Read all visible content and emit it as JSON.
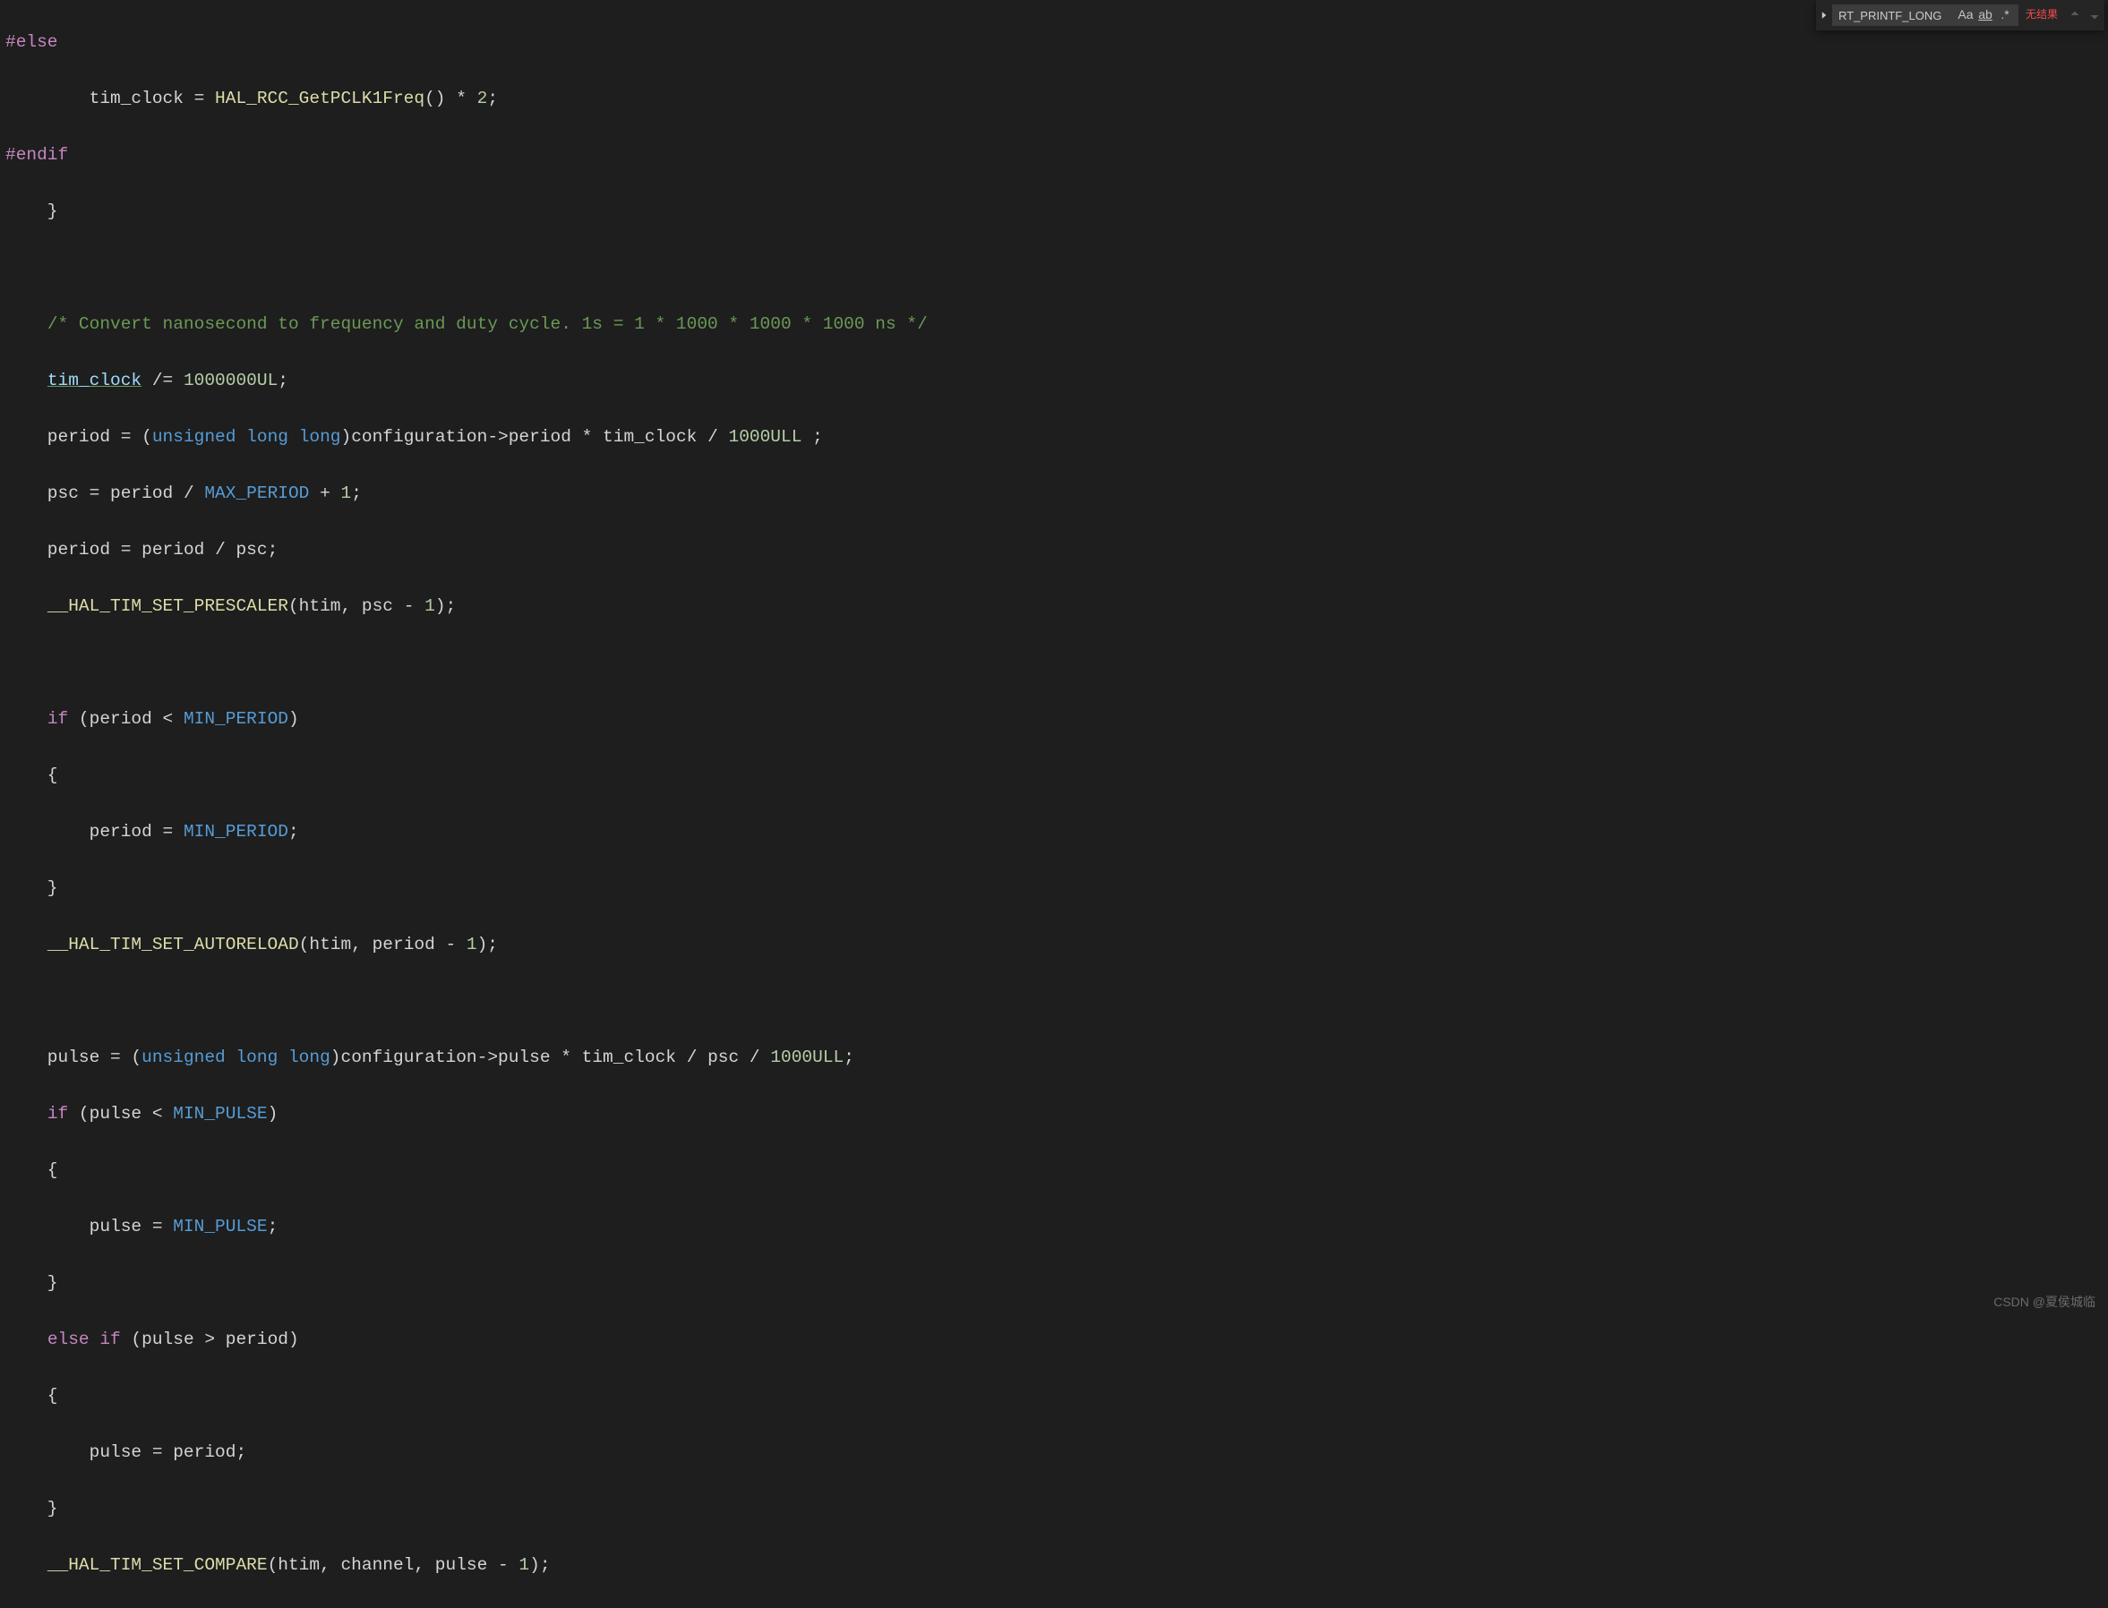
{
  "find": {
    "value": "RT_PRINTF_LONG",
    "result": "无结果",
    "opt_case": "Aa",
    "opt_word": "ab",
    "opt_regex": ".*"
  },
  "watermark": "CSDN @夏侯城临",
  "code": {
    "l0": {
      "a": "#else"
    },
    "l1": {
      "a": "        tim_clock ",
      "b": "=",
      "c": " ",
      "d": "HAL_RCC_GetPCLK1Freq",
      "e": "() ",
      "f": "*",
      "g": " ",
      "h": "2",
      "i": ";"
    },
    "l2": {
      "a": "#endif"
    },
    "l3": {
      "a": "    }"
    },
    "l4": {
      "a": ""
    },
    "l5": {
      "a": "    ",
      "b": "/* Convert nanosecond to frequency and duty cycle. 1s = 1 * 1000 * 1000 * 1000 ns */"
    },
    "l6": {
      "a": "    ",
      "b": "tim_clock",
      "c": " ",
      "d": "/=",
      "e": " ",
      "f": "1000000UL",
      "g": ";"
    },
    "l7": {
      "a": "    period ",
      "b": "=",
      "c": " (",
      "d": "unsigned",
      "e": " ",
      "f": "long",
      "g": " ",
      "h": "long",
      "i": ")configuration",
      "j": "->",
      "k": "period ",
      "l": "*",
      "m": " tim_clock ",
      "n": "/",
      "o": " ",
      "p": "1000ULL",
      "q": " ;"
    },
    "l8": {
      "a": "    psc ",
      "b": "=",
      "c": " period ",
      "d": "/",
      "e": " ",
      "f": "MAX_PERIOD",
      "g": " ",
      "h": "+",
      "i": " ",
      "j": "1",
      "k": ";"
    },
    "l9": {
      "a": "    period ",
      "b": "=",
      "c": " period ",
      "d": "/",
      "e": " psc;"
    },
    "l10": {
      "a": "    ",
      "b": "__HAL_TIM_SET_PRESCALER",
      "c": "(htim, psc ",
      "d": "-",
      "e": " ",
      "f": "1",
      "g": ");"
    },
    "l11": {
      "a": ""
    },
    "l12": {
      "a": "    ",
      "b": "if",
      "c": " (period ",
      "d": "<",
      "e": " ",
      "f": "MIN_PERIOD",
      "g": ")"
    },
    "l13": {
      "a": "    {"
    },
    "l14": {
      "a": "        period ",
      "b": "=",
      "c": " ",
      "d": "MIN_PERIOD",
      "e": ";"
    },
    "l15": {
      "a": "    }"
    },
    "l16": {
      "a": "    ",
      "b": "__HAL_TIM_SET_AUTORELOAD",
      "c": "(htim, period ",
      "d": "-",
      "e": " ",
      "f": "1",
      "g": ");"
    },
    "l17": {
      "a": ""
    },
    "l18": {
      "a": "    pulse ",
      "b": "=",
      "c": " (",
      "d": "unsigned",
      "e": " ",
      "f": "long",
      "g": " ",
      "h": "long",
      "i": ")configuration",
      "j": "->",
      "k": "pulse ",
      "l": "*",
      "m": " tim_clock ",
      "n": "/",
      "o": " psc ",
      "p": "/",
      "q": " ",
      "r": "1000ULL",
      "s": ";"
    },
    "l19": {
      "a": "    ",
      "b": "if",
      "c": " (pulse ",
      "d": "<",
      "e": " ",
      "f": "MIN_PULSE",
      "g": ")"
    },
    "l20": {
      "a": "    {"
    },
    "l21": {
      "a": "        pulse ",
      "b": "=",
      "c": " ",
      "d": "MIN_PULSE",
      "e": ";"
    },
    "l22": {
      "a": "    }"
    },
    "l23": {
      "a": "    ",
      "b": "else",
      "c": " ",
      "d": "if",
      "e": " (pulse ",
      "f": ">",
      "g": " period)"
    },
    "l24": {
      "a": "    {"
    },
    "l25": {
      "a": "        pulse ",
      "b": "=",
      "c": " period;"
    },
    "l26": {
      "a": "    }"
    },
    "l27": {
      "a": "    ",
      "b": "__HAL_TIM_SET_COMPARE",
      "c": "(htim, channel, pulse ",
      "d": "-",
      "e": " ",
      "f": "1",
      "g": ");"
    }
  }
}
